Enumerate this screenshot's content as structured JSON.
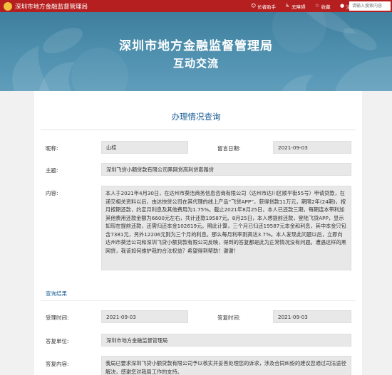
{
  "topbar": {
    "site_title": "深圳市地方金融监督管理局",
    "links": [
      "长者助手",
      "无障碍",
      "收藏",
      "注册"
    ],
    "search_placeholder": "请输入搜索内容"
  },
  "banner": {
    "title": "深圳市地方金融监督管理局",
    "subtitle": "互动交流"
  },
  "page_heading": "办理情况查询",
  "fields": {
    "nickname_label": "昵称:",
    "nickname_value": "山桂",
    "date_label": "留言日期:",
    "date_value": "2021-09-03",
    "subject_label": "主题:",
    "subject_value": "深圳飞贷小额贷款有限公司黑网贷高利贷套路贷",
    "content_label": "内容:",
    "content_value": "本人于2021年4月30日，在达州市葵洁商务信息咨询有限公司（达州市达川区顺平街55号）申请贷款，在递交相关资料以后，由达快贷公司在其代理的线上产品“飞贷APP”，获得贷款11万元，期限2年(24期)，按月按期还款，约定月利息及其他费用为1.75%。截止2021年8月25日，本人已还款三期，每期连本带利加其他费用还款金额为6600元左右，共计还款19587元。8月25日，本人想提前还款，登陆飞贷APP，显示如现在提前还款，还需归还本金102619元。照此计算，三个月已归还19587元本金和利息，其中本金只包含7381元，另外12206元则为三个月的利息。那么每月利率则高达3.7%。本人发现此问题以后，立即向达州市葵洁公司和深圳飞贷小额贷款有限公司反映，得到的答复都是此为正常情况没有问题。遭遇这样的黑网贷，我该如何维护我的合法权益？希望得到帮助！谢谢！"
  },
  "result": {
    "section_title": "查询结果",
    "accept_time_label": "受理时间:",
    "accept_time_value": "2021-09-03",
    "reply_time_label": "答复时间:",
    "reply_time_value": "2021-09-03",
    "unit_label": "答复单位:",
    "unit_value": "深圳市地方金融监督管理局",
    "reply_label": "答复内容:",
    "reply_value": "我局已要求深圳飞贷小额贷款有限公司予以核实并妥善处理您的诉求，涉及合同纠纷的建议您通过司法途径解决，感谢您对我局工作的支持。"
  },
  "colors": {
    "topbar": "#b51f1f",
    "banner": "#4a89a8",
    "heading_blue": "#1e6098",
    "field_bg": "#e8e8e8"
  }
}
